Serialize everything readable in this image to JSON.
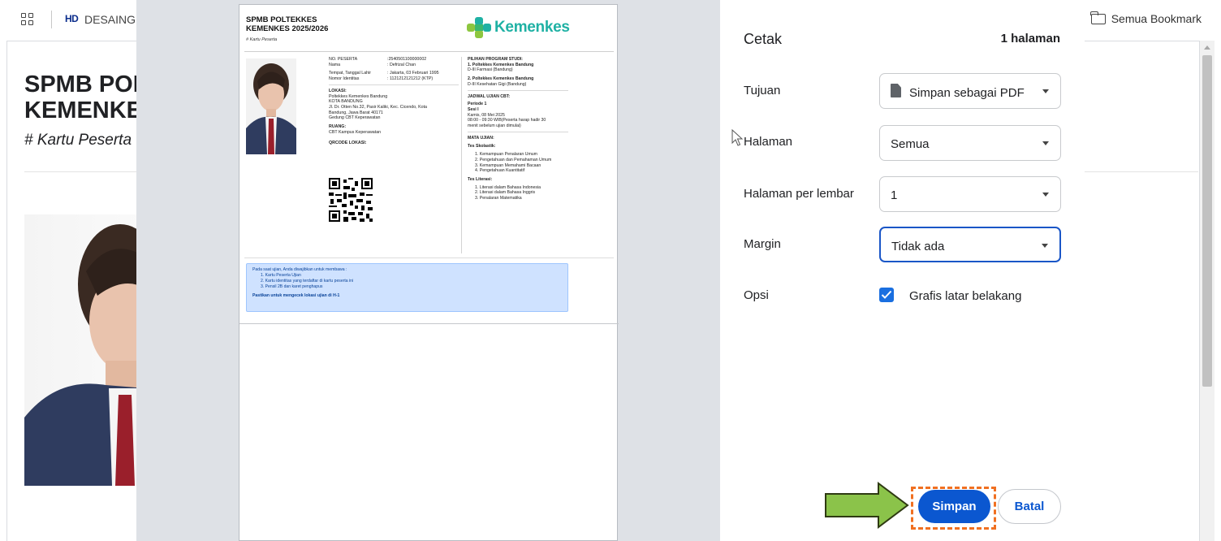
{
  "bookmarks_bar": {
    "site_logo": "HD",
    "site_label": "DESAINGR",
    "all_bookmarks": "Semua Bookmark"
  },
  "background_page": {
    "title": "SPMB POLTEKKES KEMENKES",
    "subtitle": "# Kartu Peserta"
  },
  "card": {
    "title_line1": "SPMB POLTEKKES",
    "title_line2": "KEMENKES 2025/2026",
    "subtitle": "# Kartu Peserta",
    "logo_text": "Kemenkes",
    "fields": [
      {
        "k": "NO. PESERTA",
        "v": ":2540501100000002"
      },
      {
        "k": "Nama",
        "v": ": Defrizal Chan"
      },
      {
        "k": "Tempat, Tanggal Lahir",
        "v": ": Jakarta, 03 Februari 1995"
      },
      {
        "k": "Nomor Identitas",
        "v": ": 1121212121212 (KTP)"
      }
    ],
    "lokasi_label": "LOKASI:",
    "lokasi_lines": [
      "Poltekkes Kemenkes Bandung",
      "KOTA BANDUNG",
      "Jl. Dr. Otten No.32, Pasir Kaliki, Kec. Cicendo, Kota",
      "Bandung, Jawa Barat 40171",
      "Gedung CBT Keperawatan"
    ],
    "ruang_label": "RUANG:",
    "ruang_value": "CBT Kampus Keperawatan",
    "qr_label": "QRCODE LOKASI:",
    "program_label": "PILIHAN PROGRAM STUDI:",
    "program_1_title": "1. Poltekkes Kemenkes Bandung",
    "program_1_sub": "D-III Farmasi (Bandung)",
    "program_2_title": "2. Poltekkes Kemenkes Bandung",
    "program_2_sub": "D-III Kesehatan Gigi (Bandung)",
    "jadwal_label": "JADWAL UJIAN CBT:",
    "periode": "Periode 1",
    "sesi": "Sesi I",
    "tanggal": "Kamis, 08 Mei 2025",
    "waktu_1": "08:00 - 09:30 WIB(Peserta harap hadir 30",
    "waktu_2": "menit sebelum ujian dimulai)",
    "mata_ujian_label": "MATA UJIAN:",
    "skolastik_label": "Tes Skolastik:",
    "skolastik_items": [
      "1. Kemampuan Penalaran Umum",
      "2. Pengetahuan dan Pemahaman Umum",
      "3. Kemampuan Memahami Bacaan",
      "4. Pengetahuan Kuantitatif"
    ],
    "literasi_label": "Tes Literasi:",
    "literasi_items": [
      "1. Literasi dalam Bahasa Indonesia",
      "2. Literasi dalam Bahasa Inggris",
      "3. Penalaran Matematika"
    ],
    "note_intro": "Pada saat ujian, Anda diwajibkan untuk membawa :",
    "note_items": [
      "1. Kartu Peserta Ujian",
      "2. Kartu identitas yang terdaftar di kartu peserta ini",
      "3. Pensil 2B dan karet penghapus"
    ],
    "note_strong": "Pastikan untuk mengecek lokasi ujian di H-1"
  },
  "print": {
    "title": "Cetak",
    "page_count": "1 halaman",
    "destination_label": "Tujuan",
    "destination_value": "Simpan sebagai PDF",
    "pages_label": "Halaman",
    "pages_value": "Semua",
    "per_sheet_label": "Halaman per lembar",
    "per_sheet_value": "1",
    "margin_label": "Margin",
    "margin_value": "Tidak ada",
    "options_label": "Opsi",
    "bg_graphics_label": "Grafis latar belakang",
    "bg_graphics_checked": true,
    "save_label": "Simpan",
    "cancel_label": "Batal"
  },
  "colors": {
    "accent": "#0b57d0",
    "annotation_arrow": "#8bc34a",
    "annotation_box": "#f07021",
    "kemenkes_teal": "#1fb1a4"
  }
}
